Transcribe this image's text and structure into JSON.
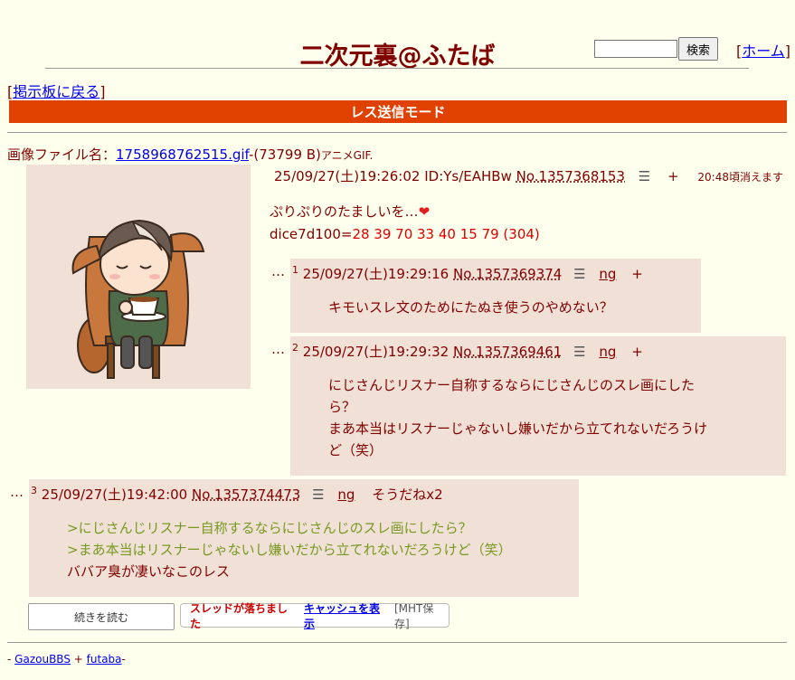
{
  "header": {
    "title": "二次元裏@ふたば",
    "search_button": "検索",
    "home_link": "ホーム",
    "back_link": "掲示板に戻る",
    "mode_label": "レス送信モード"
  },
  "file": {
    "label": "画像ファイル名：",
    "name": "1758968762515.gif",
    "size": "-(73799 B)",
    "note": "アニメGIF."
  },
  "op": {
    "datetime": "25/09/27(土)19:26:02",
    "id": "ID:Ys/EAHBw",
    "number": "No.1357368153",
    "plus": "+",
    "expiry": "20:48頃消えます",
    "body_line1": "ぷりぷりのたましいを…",
    "dice_label": "dice7d100=",
    "dice_result": "28 39 70 33 40 15 79 (304)"
  },
  "replies": [
    {
      "index": "1",
      "datetime": "25/09/27(土)19:29:16",
      "number": "No.1357369374",
      "ng": "ng",
      "plus": "+",
      "body": [
        "キモいスレ文のためにたぬき使うのやめない？"
      ]
    },
    {
      "index": "2",
      "datetime": "25/09/27(土)19:29:32",
      "number": "No.1357369461",
      "ng": "ng",
      "plus": "+",
      "body": [
        "にじさんじリスナー自称するならにじさんじのスレ画にした",
        "ら？",
        "まあ本当はリスナーじゃないし嫌いだから立てれないだろうけ",
        "ど（笑）"
      ]
    },
    {
      "index": "3",
      "datetime": "25/09/27(土)19:42:00",
      "number": "No.1357374473",
      "ng": "ng",
      "soudane": "そうだねx2",
      "quotes": [
        ">にじさんじリスナー自称するならにじさんじのスレ画にしたら？",
        ">まあ本当はリスナーじゃないし嫌いだから立てれないだろうけど（笑）"
      ],
      "body": [
        "ババア臭が凄いなこのレス"
      ]
    }
  ],
  "ellipsis": "…",
  "footer": {
    "more_button": "続きを読む",
    "thread_dead": "スレッドが落ちました",
    "cache_link": "キャッシュを表示",
    "mht": "[MHT保存]",
    "dash": "-",
    "gazou": "GazouBBS",
    "plus": "+",
    "futaba": "futaba"
  },
  "colors": {
    "background": "#FFFFEE",
    "text": "#800000",
    "reply_bg": "#F0E0D6",
    "mode_bar": "#E04000",
    "quote": "#789922",
    "dice": "#DD0000"
  }
}
